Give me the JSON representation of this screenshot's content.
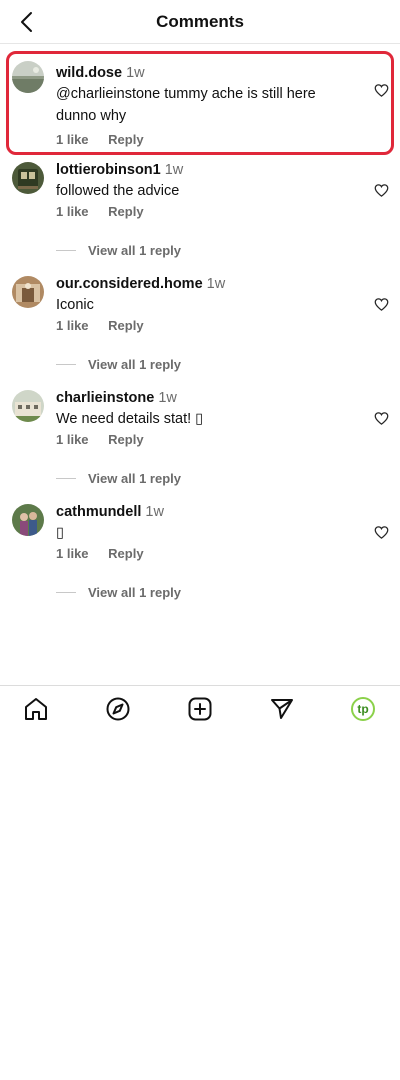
{
  "header": {
    "title": "Comments",
    "back_icon": "chevron-left-icon"
  },
  "comments": [
    {
      "username": "wild.dose",
      "time": "1w",
      "text": "@charlieinstone tummy ache is still here dunno why",
      "likes": "1 like",
      "reply_label": "Reply",
      "highlighted": true,
      "avatar": "landscape-photo"
    },
    {
      "username": "lottierobinson1",
      "time": "1w",
      "text": "followed the advice",
      "likes": "1 like",
      "reply_label": "Reply",
      "view_replies": "View all 1 reply",
      "avatar": "train-photo"
    },
    {
      "username": "our.considered.home",
      "time": "1w",
      "text": "Iconic",
      "likes": "1 like",
      "reply_label": "Reply",
      "view_replies": "View all 1 reply",
      "avatar": "interior-photo"
    },
    {
      "username": "charlieinstone",
      "time": "1w",
      "text": "We need details stat! ▯",
      "likes": "1 like",
      "reply_label": "Reply",
      "view_replies": "View all 1 reply",
      "avatar": "building-photo"
    },
    {
      "username": "cathmundell",
      "time": "1w",
      "text": "▯",
      "likes": "1 like",
      "reply_label": "Reply",
      "view_replies": "View all 1 reply",
      "avatar": "people-photo"
    }
  ],
  "tabbar": {
    "items": [
      "home-icon",
      "explore-compass-icon",
      "create-plus-icon",
      "direct-send-icon",
      "profile-avatar"
    ],
    "profile_initials": "tp",
    "accent_color": "#8bd14a"
  },
  "colors": {
    "highlight_border": "#e0283a",
    "muted_text": "#6b6b6b"
  }
}
